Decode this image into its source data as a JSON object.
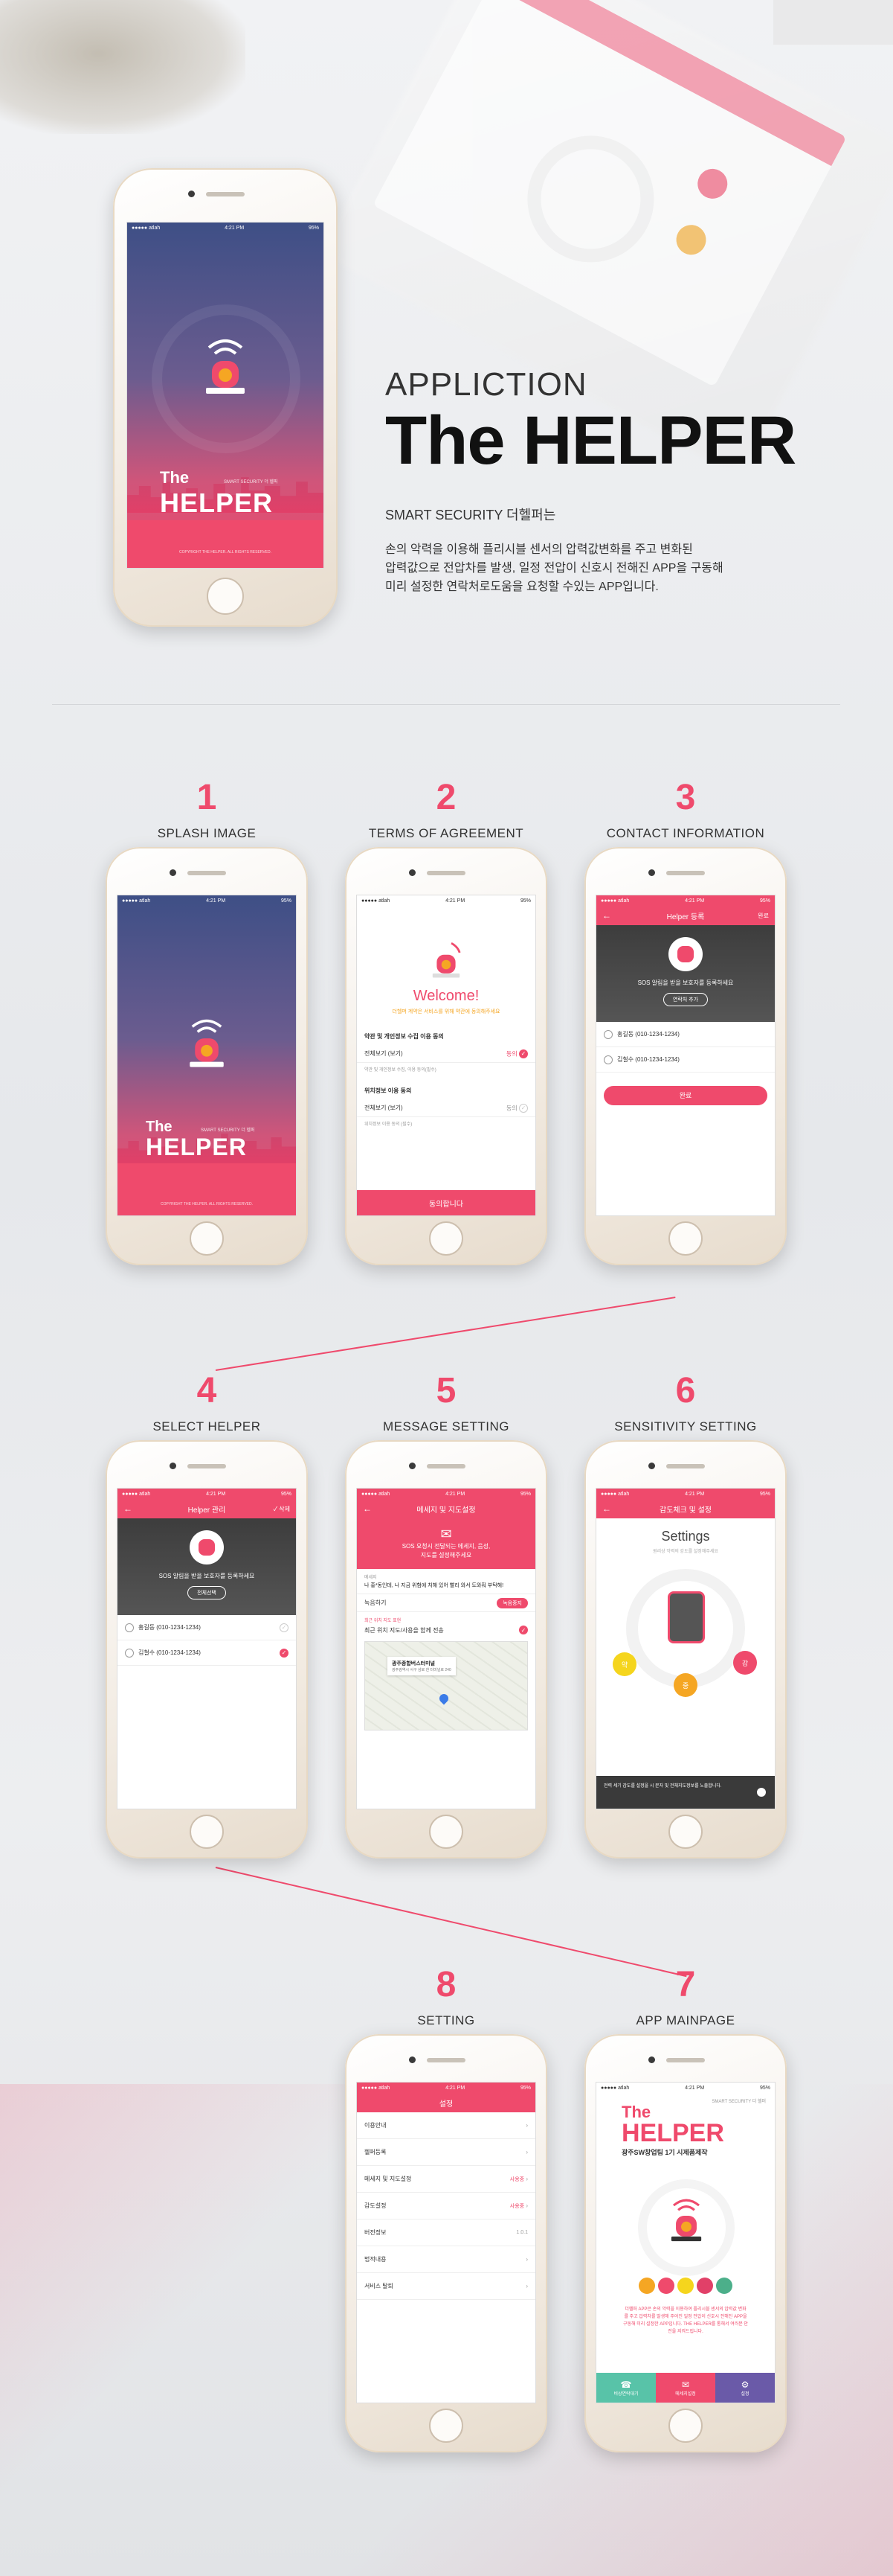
{
  "hero": {
    "appliction": "APPLICTION",
    "title": "The HELPER",
    "subtitle": "SMART SECURITY 더헬퍼는",
    "desc_line1": "손의 악력을 이용해 플리시블 센서의 압력값변화를 주고 변화된",
    "desc_line2": "압력값으로 전압차를 발생, 일정 전압이 신호시 전해진 APP을 구동해",
    "desc_line3": "미리 설정한 연락처로도움을 요청할 수있는 APP입니다."
  },
  "splash": {
    "status_carrier": "●●●●● atlah",
    "status_time": "4:21 PM",
    "status_battery": "95%",
    "the": "The",
    "helper": "HELPER",
    "smart": "SMART SECURITY 더 헬퍼",
    "copyright": "COPYRIGHT THE HELPER. ALL RIGHTS RESERVED."
  },
  "steps": [
    {
      "num": "1",
      "label": "SPLASH IMAGE"
    },
    {
      "num": "2",
      "label": "TERMS OF AGREEMENT"
    },
    {
      "num": "3",
      "label": "CONTACT INFORMATION"
    },
    {
      "num": "4",
      "label": "SELECT HELPER"
    },
    {
      "num": "5",
      "label": "MESSAGE SETTING"
    },
    {
      "num": "6",
      "label": "SENSITIVITY SETTING"
    },
    {
      "num": "8",
      "label": "SETTING"
    },
    {
      "num": "7",
      "label": "APP MAINPAGE"
    }
  ],
  "terms": {
    "welcome": "Welcome!",
    "welcome_sub": "더헬퍼 계약은 서비스를 위해 약관에 동의해주세요",
    "sec1": "약관 및 개인정보 수집 이용 동의",
    "view_all": "전체보기 (보기)",
    "agree": "동의",
    "note1": "약관 및 개인정보 수집, 이용 동의(필수)",
    "sec2": "위치정보 이용 동의",
    "note2": "위치정보 이용 동의 (필수)",
    "button": "동의합니다"
  },
  "contact": {
    "title": "Helper 등록",
    "right": "완료",
    "sos": "SOS 알림을 받을 보호자를 등록하세요",
    "add": "연락처 추가",
    "p1": "홍길동 (010-1234-1234)",
    "p2": "김철수 (010-1234-1234)",
    "button": "완료"
  },
  "select": {
    "title": "Helper 관리",
    "right": "✓ 삭제",
    "sos": "SOS 알림을 받을 보호자를 등록하세요",
    "add": "전체선택",
    "p1": "홍길동 (010-1234-1234)",
    "p2": "김철수 (010-1234-1234)"
  },
  "message": {
    "title": "메세지 및 지도설정",
    "banner1": "SOS 요청시 전달되는 메세지, 음성,",
    "banner2": "지도를 설정해주세요",
    "msg_label": "메세지",
    "msg": "나 홍*동인데, 나 지금 위험에 처해 있어 빨리 와서 도와줘 부탁해!",
    "voice": "녹음하기",
    "voice_btn": "녹음중지",
    "loc_label": "최근 위치 지도 표현",
    "loc": "최근 위치 지도/사용을 함께 전송",
    "map_title": "광주종합버스터미널",
    "map_sub": "광주광역시 서구 삼로 한 터미널로 240"
  },
  "sensitivity": {
    "title": "감도체크 및 설정",
    "heading": "Settings",
    "sub": "원리상 악력의 강도를 설정해주세요",
    "weak": "약",
    "mid": "중",
    "strong": "강",
    "note": "전력 세기 감도를 설정을 시 문자 및 전체지도정보를 노출합니다."
  },
  "setting": {
    "title": "설정",
    "items": [
      {
        "label": "이용안내",
        "value": ""
      },
      {
        "label": "헬퍼등록",
        "value": ""
      },
      {
        "label": "메세지 및 지도설정",
        "value": "사용중"
      },
      {
        "label": "감도설정",
        "value": "사용중"
      },
      {
        "label": "버전정보",
        "value": "1.0.1"
      },
      {
        "label": "법적내용",
        "value": ""
      },
      {
        "label": "서비스 탈퇴",
        "value": ""
      }
    ]
  },
  "main": {
    "smart": "SMART SECURITY 더 헬퍼",
    "the": "The",
    "helper": "HELPER",
    "team": "광주SW창업팀 1기 시제품제작",
    "para": "더헬퍼 APP은 손의 악력을 이용하여 플리시블 센서의 압력값 변화를 주고 압력차를 발생해 주어진 일정 전압이 신호시 전해진 APP을 구동해 미리 설정한 APP입니다. THE HELPER를 통해서 여러분 안전을 지켜드립니다.",
    "tab1": "비상연락대기",
    "tab2": "메세지설정",
    "tab3": "설정"
  },
  "colors": {
    "accent": "#ef4a6c",
    "dark": "#3d3d3d",
    "splash_top": "#3e4f86"
  }
}
